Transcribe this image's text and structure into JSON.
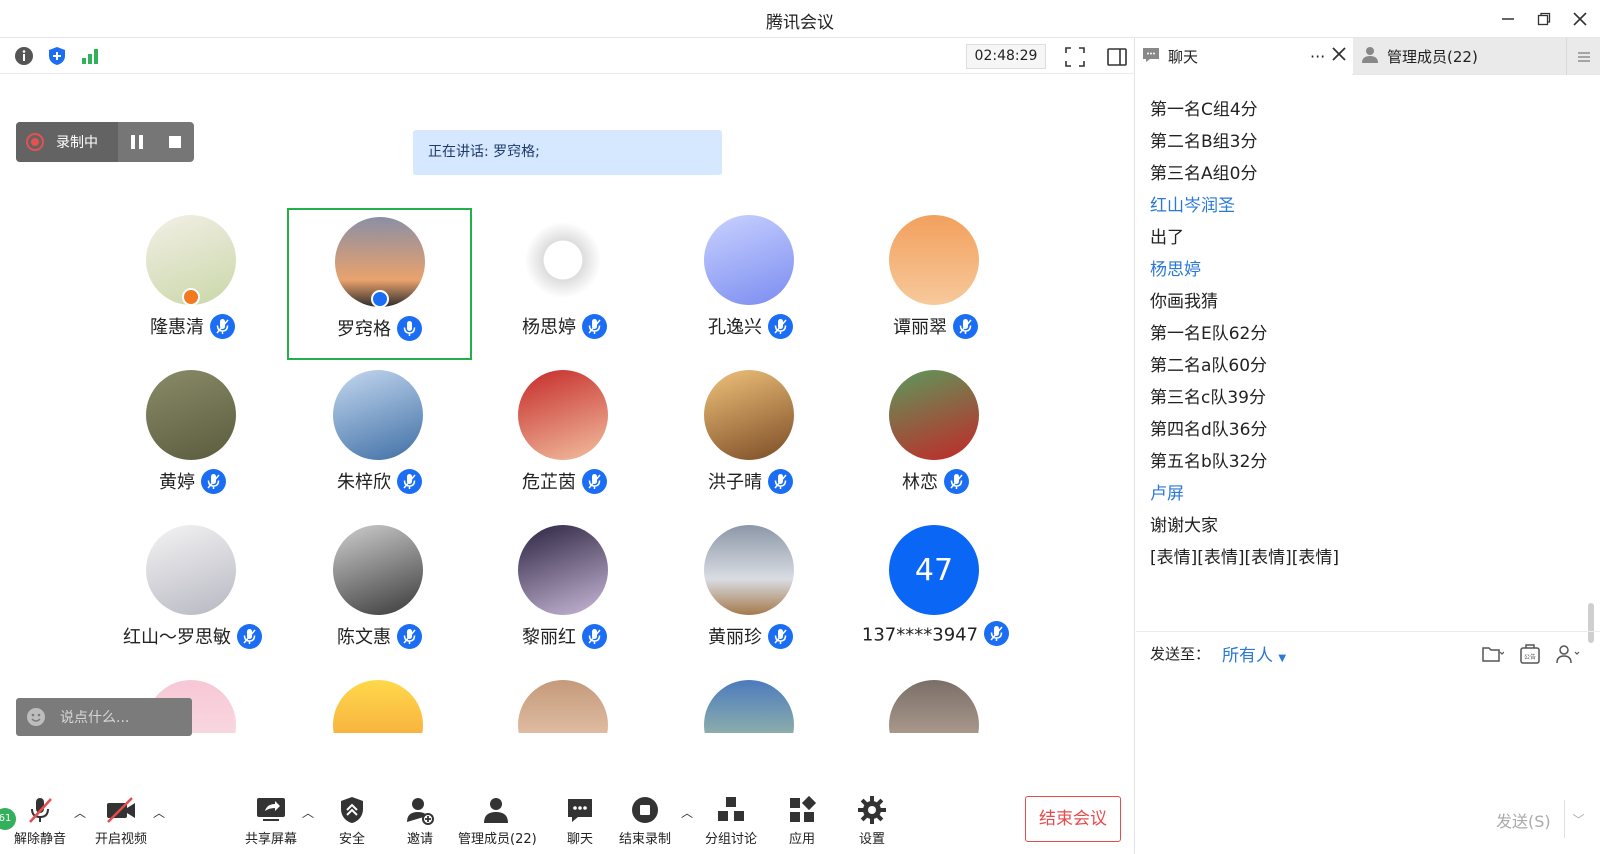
{
  "window": {
    "title": "腾讯会议"
  },
  "toolbar_top": {
    "timer": "02:48:29"
  },
  "recording": {
    "label": "录制中"
  },
  "speaking": {
    "text": "正在讲话: 罗窍格;"
  },
  "participants": [
    {
      "name": "隆惠清"
    },
    {
      "name": "罗窍格"
    },
    {
      "name": "杨思婷"
    },
    {
      "name": "孔逸兴"
    },
    {
      "name": "谭丽翠"
    },
    {
      "name": "黄婷"
    },
    {
      "name": "朱梓欣"
    },
    {
      "name": "危芷茵"
    },
    {
      "name": "洪子晴"
    },
    {
      "name": "林恋"
    },
    {
      "name": "红山～罗思敏"
    },
    {
      "name": "陈文惠"
    },
    {
      "name": "黎丽红"
    },
    {
      "name": "黄丽珍"
    },
    {
      "name": "137****3947",
      "avatar_text": "47"
    }
  ],
  "chat_input": {
    "placeholder": "说点什么..."
  },
  "bottom": {
    "badge": "61",
    "unmute": "解除静音",
    "video": "开启视频",
    "share": "共享屏幕",
    "security": "安全",
    "invite": "邀请",
    "members": "管理成员(22)",
    "chat": "聊天",
    "stop_record": "结束录制",
    "breakout": "分组讨论",
    "apps": "应用",
    "settings": "设置",
    "end": "结束会议"
  },
  "side": {
    "tab_chat": "聊天",
    "tab_members": "管理成员(22)",
    "messages": [
      {
        "text": "第一名C组4分",
        "sender": false
      },
      {
        "text": "第二名B组3分",
        "sender": false
      },
      {
        "text": "第三名A组0分",
        "sender": false
      },
      {
        "text": "红山岑润圣",
        "sender": true
      },
      {
        "text": "出了",
        "sender": false
      },
      {
        "text": "杨思婷",
        "sender": true
      },
      {
        "text": "你画我猜",
        "sender": false
      },
      {
        "text": "第一名E队62分",
        "sender": false
      },
      {
        "text": "第二名a队60分",
        "sender": false
      },
      {
        "text": "第三名c队39分",
        "sender": false
      },
      {
        "text": "第四名d队36分",
        "sender": false
      },
      {
        "text": "第五名b队32分",
        "sender": false
      },
      {
        "text": "卢屏",
        "sender": true
      },
      {
        "text": "谢谢大家",
        "sender": false
      },
      {
        "text": "[表情][表情][表情][表情]",
        "sender": false
      }
    ],
    "send_to_label": "发送至：",
    "send_to_value": "所有人",
    "notice_label": "公告",
    "send_button": "发送(S)"
  },
  "colors": {
    "accent": "#1b6ef3",
    "danger": "#e84b4b",
    "active_border": "#23b04a",
    "sender": "#2b78d6"
  }
}
